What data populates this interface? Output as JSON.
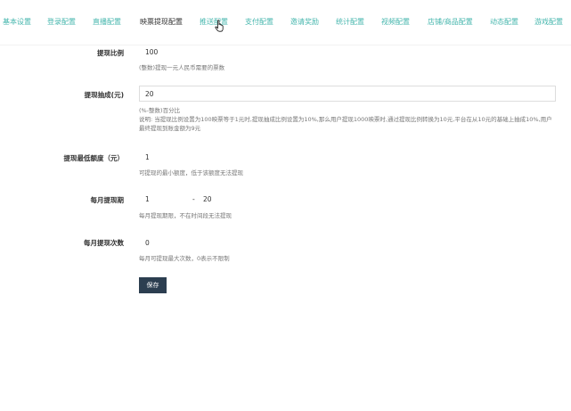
{
  "tabs": [
    {
      "label": "基本设置"
    },
    {
      "label": "登录配置"
    },
    {
      "label": "直播配置"
    },
    {
      "label": "映票提现配置"
    },
    {
      "label": "推送配置"
    },
    {
      "label": "支付配置"
    },
    {
      "label": "邀请奖励"
    },
    {
      "label": "统计配置"
    },
    {
      "label": "视频配置"
    },
    {
      "label": "店铺/商品配置"
    },
    {
      "label": "动态配置"
    },
    {
      "label": "游戏配置"
    }
  ],
  "active_tab": "映票提现配置",
  "colors": {
    "tab_link": "#45b6ad",
    "save_button": "#2c3e50",
    "help_text": "#777777"
  },
  "form": {
    "ratio": {
      "label": "提现比例",
      "value": "100",
      "help": "(整数)提现一元人民币需要的票数"
    },
    "commission": {
      "label": "提现抽成(元)",
      "value": "20",
      "help1": "(%-整数)百分比",
      "help2": "说明: 当提现比例设置为100映票等于1元时,提现抽成比例设置为10%,那么用户提现1000映票时,通过提现比例转换为10元,平台在从10元的基础上抽成10%,用户最终提现到账金额为9元"
    },
    "min_amount": {
      "label": "提现最低额度（元）",
      "value": "1",
      "help": "可提现的最小额度，低于该额度无法提现"
    },
    "period": {
      "label": "每月提现期",
      "start": "1",
      "separator": "-",
      "end": "20",
      "help": "每月提现期限，不在时间段无法提现"
    },
    "count": {
      "label": "每月提现次数",
      "value": "0",
      "help": "每月可提现最大次数，0表示不限制"
    },
    "save_label": "保存"
  }
}
